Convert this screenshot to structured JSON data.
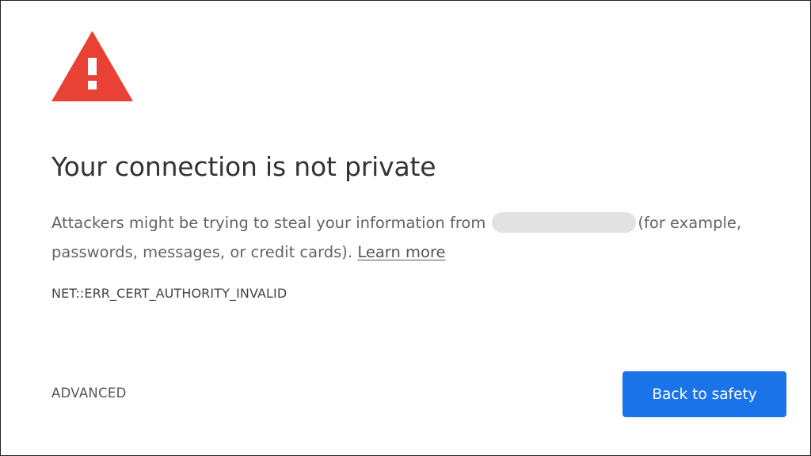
{
  "page": {
    "title": "Your connection is not private",
    "body_before_url": "Attackers might be trying to steal your information from",
    "body_after_url": "(for example, passwords, messages, or credit cards).",
    "learn_more_label": "Learn more",
    "error_code": "NET::ERR_CERT_AUTHORITY_INVALID"
  },
  "actions": {
    "advanced_label": "ADVANCED",
    "back_to_safety_label": "Back to safety"
  },
  "icons": {
    "warning": "warning-triangle-icon"
  },
  "colors": {
    "warning_red": "#e94235",
    "primary_blue": "#1a73e8",
    "redaction_gray": "#e2e2e2"
  }
}
